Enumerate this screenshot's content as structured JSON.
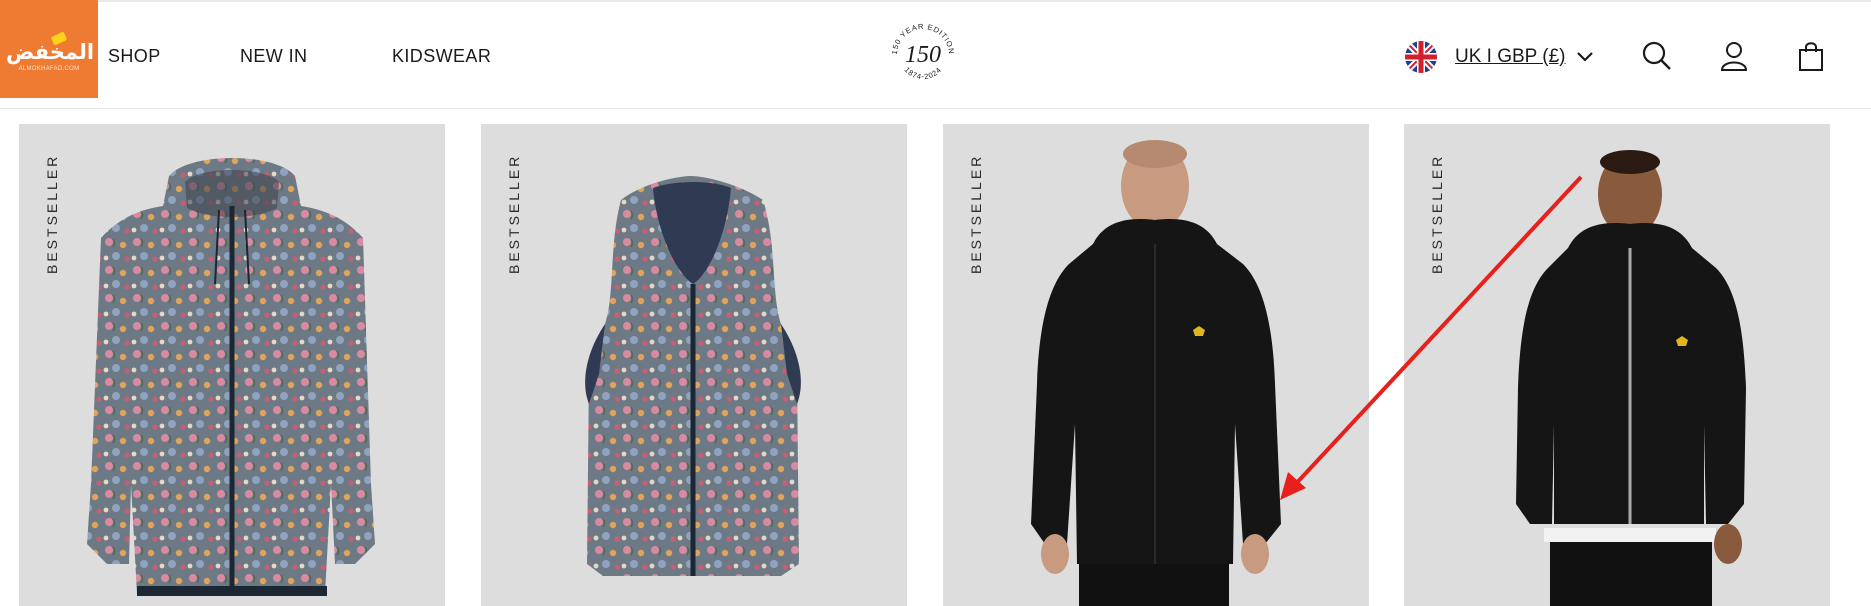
{
  "badge": {
    "text": "المخفض",
    "sub": "ALMOKHAFAD.COM",
    "color": "#ef7a32"
  },
  "nav": {
    "items": [
      "SHOP",
      "NEW IN",
      "KIDSWEAR"
    ]
  },
  "logo": {
    "top_text": "150 YEAR EDITION",
    "number": "150",
    "bottom_text": "1874-2024"
  },
  "region": {
    "label": "UK I GBP (£)",
    "flag": "uk-flag-icon"
  },
  "header_icons": [
    "search-icon",
    "account-icon",
    "bag-icon"
  ],
  "products": [
    {
      "tag": "BESTSELLER",
      "image": "floral-print-hooded-jacket"
    },
    {
      "tag": "BESTSELLER",
      "image": "floral-print-reversible-gilet"
    },
    {
      "tag": "BESTSELLER",
      "image": "black-zip-through-hooded-jacket"
    },
    {
      "tag": "BESTSELLER",
      "image": "black-hooded-bomber-jacket"
    }
  ],
  "annotation": {
    "type": "arrow",
    "color": "#e8201c"
  }
}
